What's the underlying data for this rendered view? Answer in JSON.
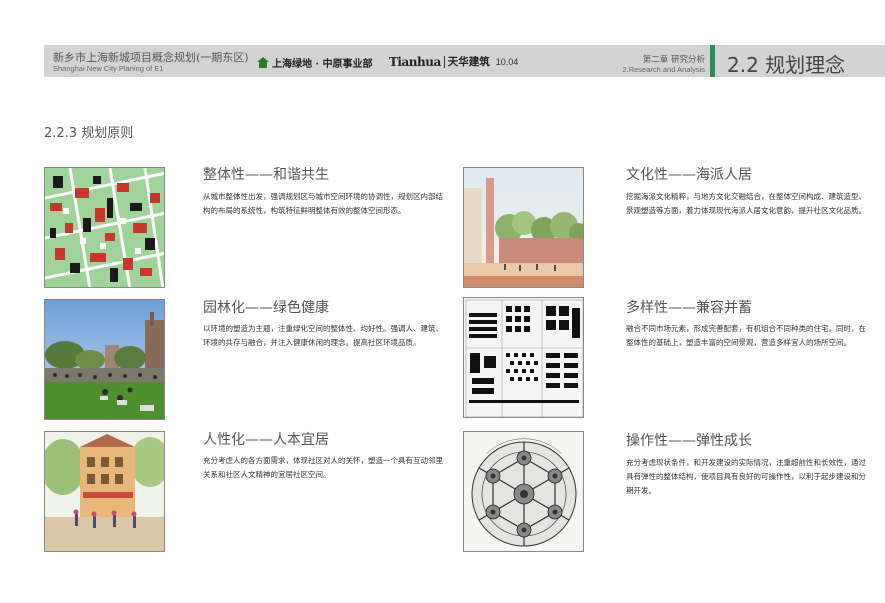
{
  "header": {
    "project_title_cn": "新乡市上海新城项目概念规划(一期东区)",
    "project_title_en": "Shanghai New City Planing of E1",
    "logo_greenland": "上海绿地 · 中原事业部",
    "logo_tianhua_en": "Tianhua",
    "logo_tianhua_cn": "天华建筑",
    "date": "10.04",
    "chapter_cn": "第二章  研究分析",
    "chapter_en": "2.Research and Analysis",
    "section_title": "2.2 规划理念",
    "accent_color": "#2e8b57"
  },
  "subsection_title": "2.2.3 规划原则",
  "principles": [
    {
      "title": "整体性——和谐共生",
      "description": "从城市整体性出发，强调规划区与城市空间环境的协调性，规划区内部结构的布局的系统性，构筑特征鲜明整体有效的整体空间形态。",
      "image": "urban-figure-ground-map"
    },
    {
      "title": "文化性——海派人居",
      "description": "挖掘海派文化精粹，与地方文化交融结合，在整体空间构成、建筑造型、景观塑造等方面，着力体现现代海派人居文化意韵，提升社区文化品质。",
      "image": "plaza-rendering"
    },
    {
      "title": "园林化——绿色健康",
      "description": "以环境的塑造为主题，注重绿化空间的整体性、均好性。强调人、建筑、环境的共存与融合，并注入健康休闲的理念。提高社区环境品质。",
      "image": "park-lawn-photo"
    },
    {
      "title": "多样性——兼容并蓄",
      "description": "融合不同市场元素，形成完善配套，有机组合不同种类的住宅。同时，在整体性的基础上，塑造丰富的空间景观，营造多样宜人的场所空间。",
      "image": "building-typology-diagram"
    },
    {
      "title": "人性化——人本宜居",
      "description": "充分考虑人的各方面需求，体现社区对人的关怀，塑造一个具有互动邻里关系和社区人文精神的宜居社区空间。",
      "image": "street-watercolor"
    },
    {
      "title": "操作性——弹性成长",
      "description": "充分考虑现状条件，和开发建设的实际情况，注重超前性和长效性，通过具有弹性的整体结构，使项目具有良好的可操作性，以利于起步建设和分期开发。",
      "image": "garden-city-diagram"
    }
  ]
}
